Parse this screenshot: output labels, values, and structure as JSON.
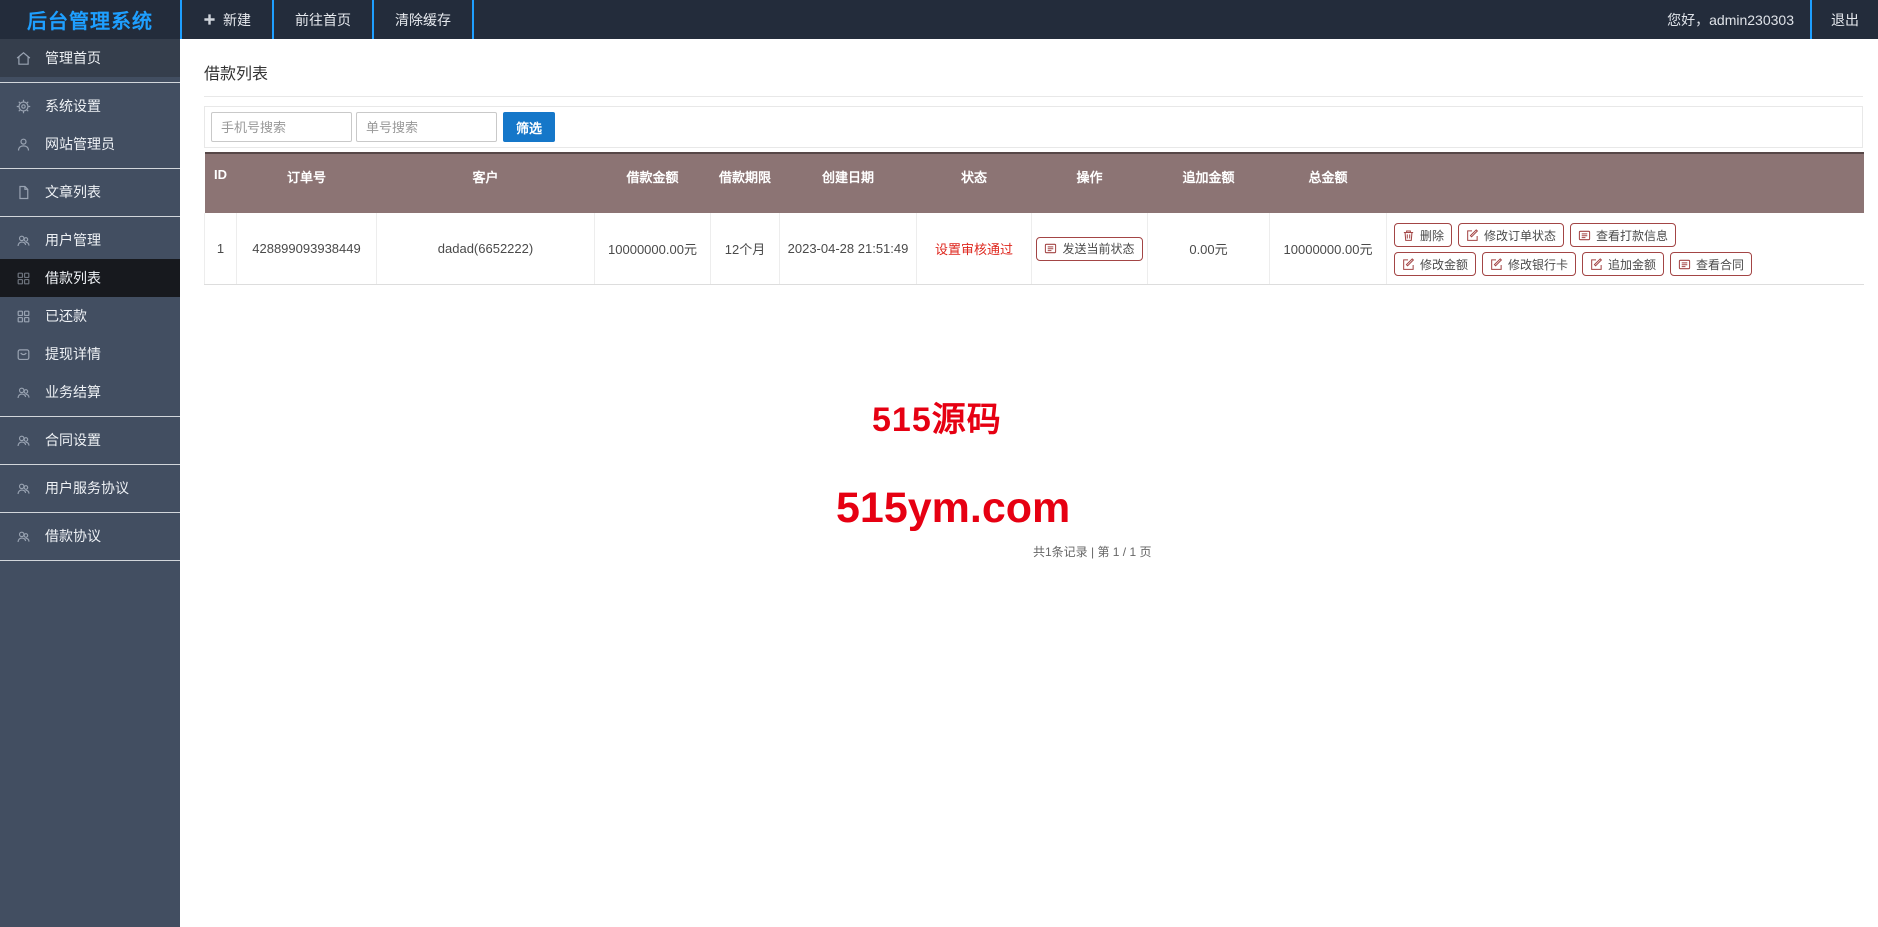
{
  "header": {
    "logo": "后台管理系统",
    "nav": [
      {
        "label": "新建",
        "icon": "plus-icon"
      },
      {
        "label": "前往首页"
      },
      {
        "label": "清除缓存"
      }
    ],
    "greeting": "您好，admin230303",
    "logout_label": "退出"
  },
  "sidebar": {
    "groups": [
      {
        "items": [
          {
            "label": "管理首页",
            "icon": "home-icon"
          }
        ]
      },
      {
        "items": [
          {
            "label": "系统设置",
            "icon": "gear-icon"
          },
          {
            "label": "网站管理员",
            "icon": "user-icon"
          }
        ]
      },
      {
        "items": [
          {
            "label": "文章列表",
            "icon": "file-icon"
          }
        ]
      },
      {
        "items": [
          {
            "label": "用户管理",
            "icon": "users-icon"
          },
          {
            "label": "借款列表",
            "icon": "grid-icon",
            "active": true
          },
          {
            "label": "已还款",
            "icon": "grid-icon"
          },
          {
            "label": "提现详情",
            "icon": "box-icon"
          },
          {
            "label": "业务结算",
            "icon": "users-icon"
          }
        ]
      },
      {
        "items": [
          {
            "label": "合同设置",
            "icon": "users-icon"
          }
        ]
      },
      {
        "items": [
          {
            "label": "用户服务协议",
            "icon": "users-icon"
          }
        ]
      },
      {
        "items": [
          {
            "label": "借款协议",
            "icon": "users-icon"
          }
        ]
      }
    ]
  },
  "main": {
    "title": "借款列表",
    "search": {
      "phone_placeholder": "手机号搜索",
      "order_placeholder": "单号搜索",
      "filter_label": "筛选"
    },
    "table": {
      "headers": [
        "ID",
        "订单号",
        "客户",
        "借款金额",
        "借款期限",
        "创建日期",
        "状态",
        "操作",
        "追加金额",
        "总金额",
        ""
      ],
      "row": {
        "id": "1",
        "order_no": "428899093938449",
        "customer": "dadad(6652222)",
        "loan_amount": "10000000.00元",
        "loan_term": "12个月",
        "created_at": "2023-04-28 21:51:49",
        "status": "设置审核通过",
        "send_status_label": "发送当前状态",
        "extra_amount": "0.00元",
        "total_amount": "10000000.00元",
        "actions_row1": [
          {
            "label": "删除",
            "icon": "trash-icon"
          },
          {
            "label": "修改订单状态",
            "icon": "edit-icon"
          },
          {
            "label": "查看打款信息",
            "icon": "list-icon"
          }
        ],
        "actions_row2": [
          {
            "label": "修改金额",
            "icon": "edit-icon"
          },
          {
            "label": "修改银行卡",
            "icon": "edit-icon"
          },
          {
            "label": "追加金额",
            "icon": "edit-icon"
          },
          {
            "label": "查看合同",
            "icon": "list-icon"
          }
        ]
      }
    },
    "pagination": "共1条记录 | 第 1 / 1 页"
  },
  "watermark": {
    "line1": "515源码",
    "line2": "515ym.com",
    "color": "#e60012"
  },
  "colors": {
    "accent_blue": "#1e9fff",
    "topbar_bg": "#232c3b",
    "sidebar_bg": "#424e61",
    "active_item_bg": "#17191e",
    "table_header_bg": "#8c7474",
    "filter_button_bg": "#1577c9",
    "danger_border": "#a34545",
    "status_red": "#de261d",
    "watermark_red": "#e60012"
  }
}
